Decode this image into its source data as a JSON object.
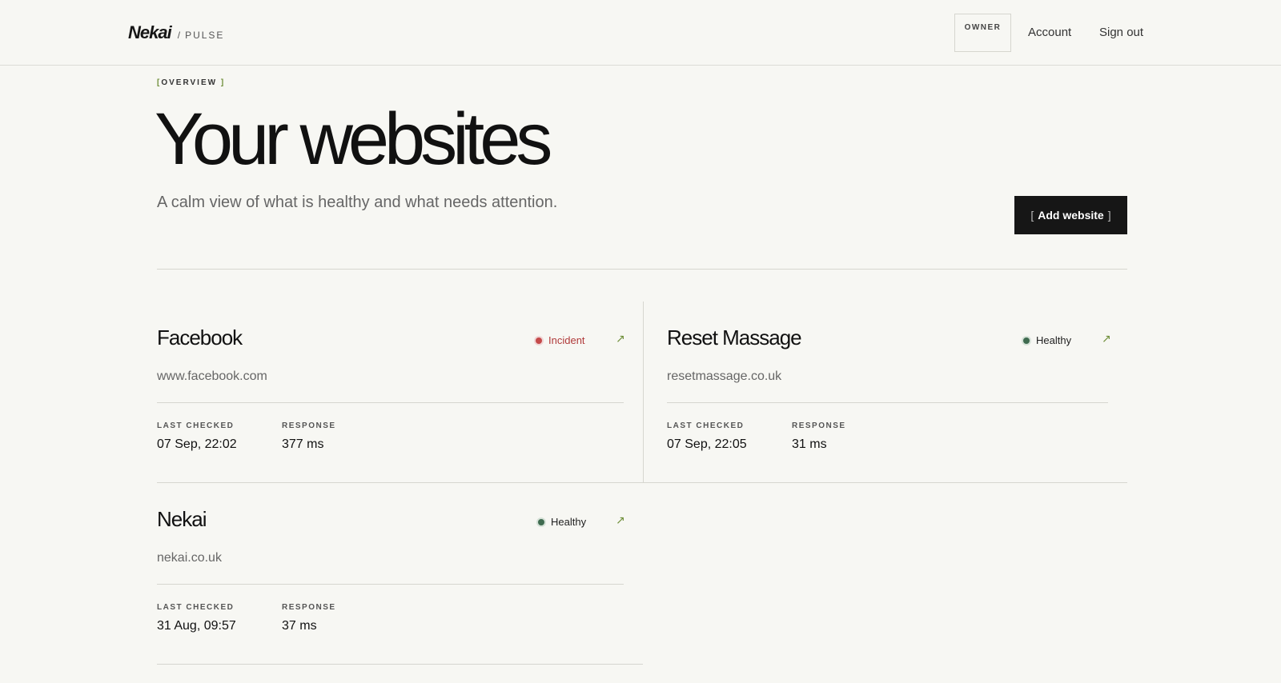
{
  "header": {
    "brand": "Nekai",
    "separator": "/",
    "product": "PULSE",
    "role_badge": "OWNER",
    "nav": {
      "account": "Account",
      "sign_out": "Sign out"
    }
  },
  "overview": {
    "eyebrow": "OVERVIEW",
    "title": "Your websites",
    "subtitle": "A calm view of what is healthy and what needs attention.",
    "add_button": "Add website"
  },
  "labels": {
    "last_checked": "LAST CHECKED",
    "response": "RESPONSE"
  },
  "websites": [
    {
      "name": "Facebook",
      "url": "www.facebook.com",
      "status": "Incident",
      "last_checked": "07 Sep, 22:02",
      "response": "377 ms"
    },
    {
      "name": "Reset Massage",
      "url": "resetmassage.co.uk",
      "status": "Healthy",
      "last_checked": "07 Sep, 22:05",
      "response": "31 ms"
    },
    {
      "name": "Nekai",
      "url": "nekai.co.uk",
      "status": "Healthy",
      "last_checked": "31 Aug, 09:57",
      "response": "37 ms"
    }
  ],
  "colors": {
    "background": "#f7f7f3",
    "accent": "#6f8f3a",
    "incident": "#c54a4a",
    "healthy": "#3f6b4f",
    "primary_button": "#161616"
  },
  "icons": {
    "external_link": "arrow-up-right-icon"
  }
}
